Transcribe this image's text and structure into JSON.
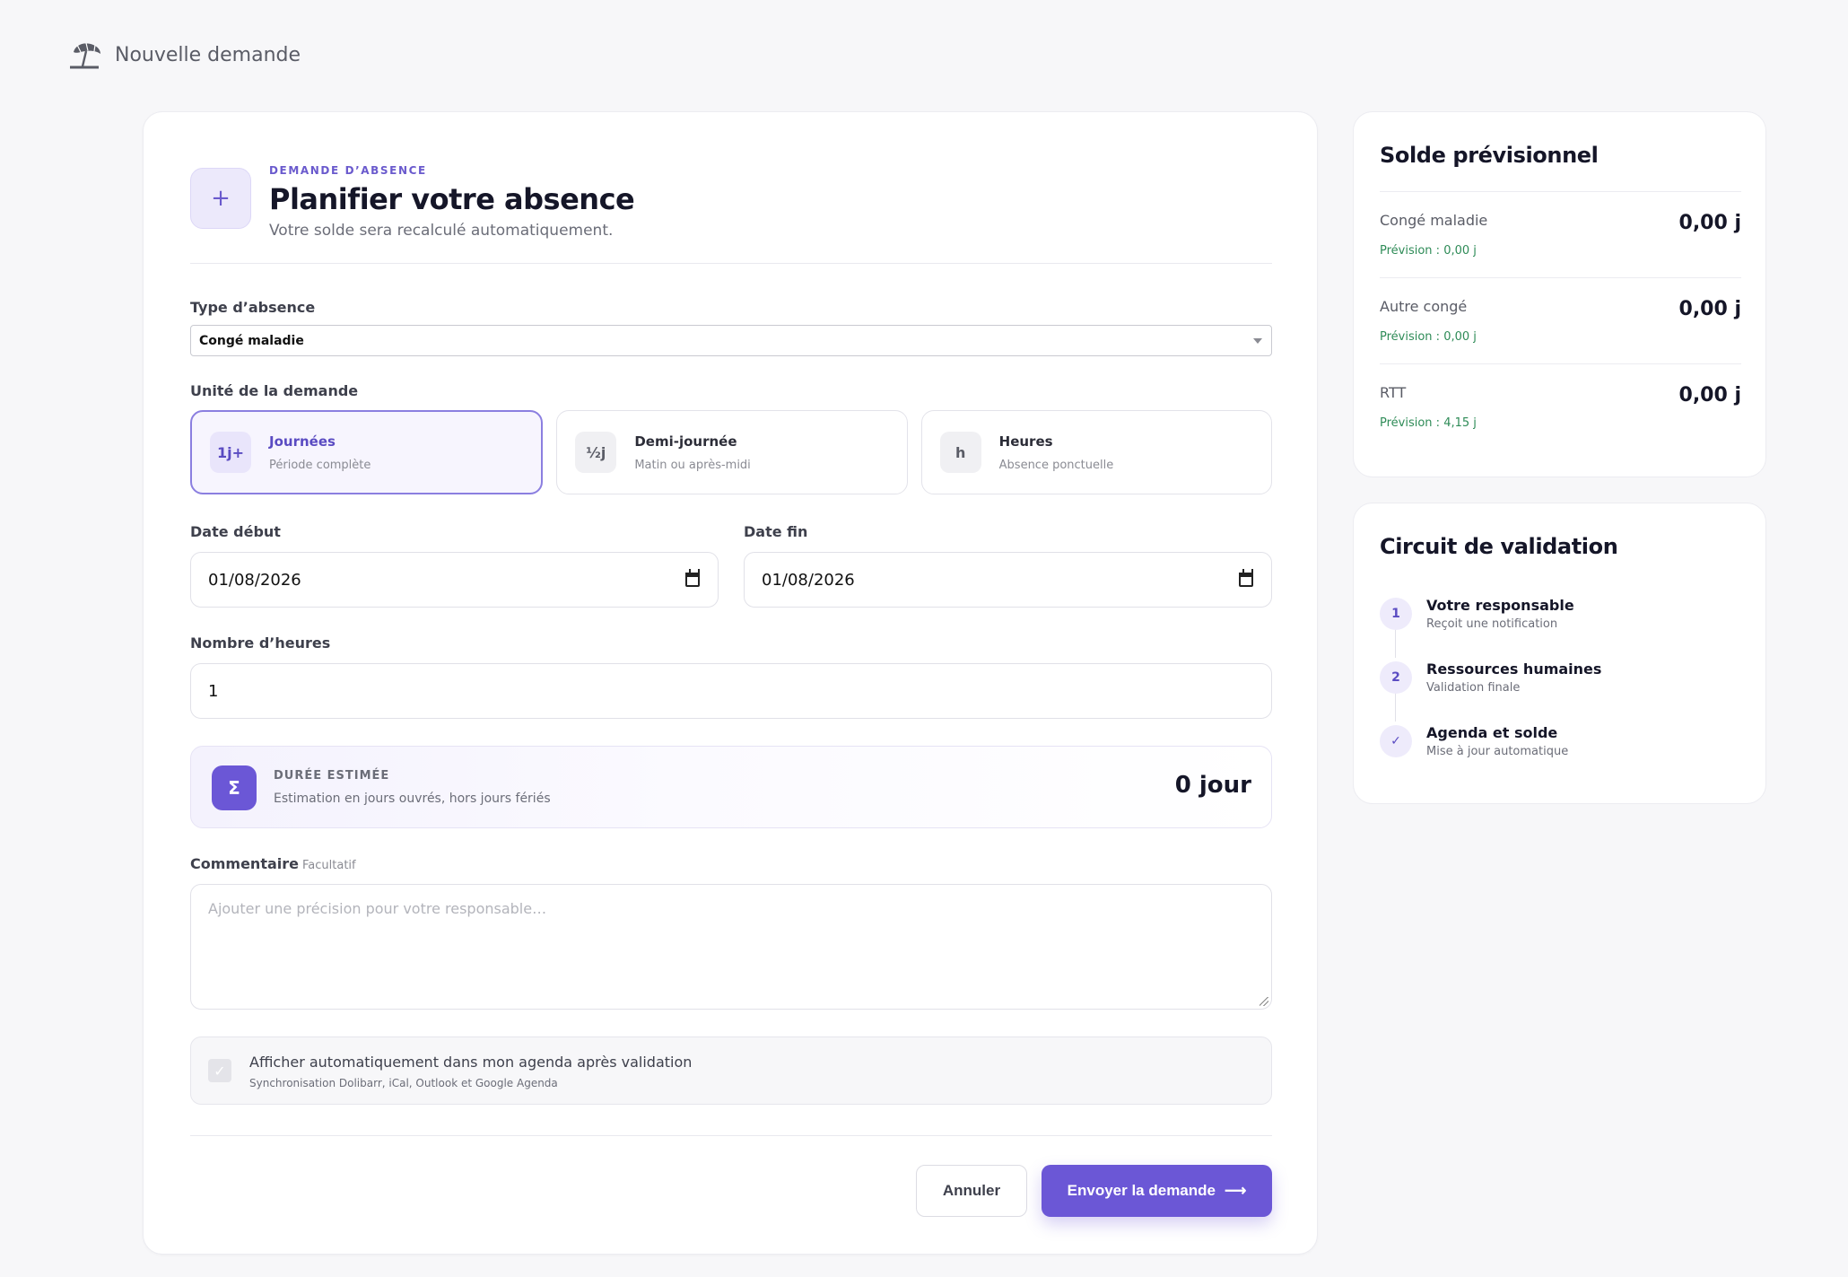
{
  "header": {
    "title": "Nouvelle demande"
  },
  "form": {
    "eyebrow": "DEMANDE D’ABSENCE",
    "title": "Planifier votre absence",
    "subtitle": "Votre solde sera recalculé automatiquement.",
    "type_label": "Type d’absence",
    "type_value": "Congé maladie",
    "unit_label": "Unité de la demande",
    "units": [
      {
        "badge": "1j+",
        "title": "Journées",
        "sub": "Période complète",
        "selected": true
      },
      {
        "badge": "½j",
        "title": "Demi-journée",
        "sub": "Matin ou après-midi",
        "selected": false
      },
      {
        "badge": "h",
        "title": "Heures",
        "sub": "Absence ponctuelle",
        "selected": false
      }
    ],
    "start_label": "Date début",
    "start_value": "01/08/2026",
    "end_label": "Date fin",
    "end_value": "01/08/2026",
    "hours_label": "Nombre d’heures",
    "hours_value": "1",
    "estimate": {
      "icon": "Σ",
      "title": "DURÉE ESTIMÉE",
      "sub": "Estimation en jours ouvrés, hors jours fériés",
      "value": "0 jour"
    },
    "comment_label": "Commentaire",
    "comment_optional": "Facultatif",
    "comment_placeholder": "Ajouter une précision pour votre responsable…",
    "sync": {
      "checked": true,
      "title": "Afficher automatiquement dans mon agenda après validation",
      "sub": "Synchronisation Dolibarr, iCal, Outlook et Google Agenda"
    },
    "cancel_label": "Annuler",
    "submit_label": "Envoyer la demande",
    "submit_arrow": "⟶"
  },
  "balance": {
    "title": "Solde prévisionnel",
    "rows": [
      {
        "name": "Congé maladie",
        "value": "0,00 j",
        "forecast": "Prévision : 0,00 j"
      },
      {
        "name": "Autre congé",
        "value": "0,00 j",
        "forecast": "Prévision : 0,00 j"
      },
      {
        "name": "RTT",
        "value": "0,00 j",
        "forecast": "Prévision : 4,15 j"
      }
    ]
  },
  "validation": {
    "title": "Circuit de validation",
    "steps": [
      {
        "marker": "1",
        "title": "Votre responsable",
        "sub": "Reçoit une notification"
      },
      {
        "marker": "2",
        "title": "Ressources humaines",
        "sub": "Validation finale"
      },
      {
        "marker": "✓",
        "title": "Agenda et solde",
        "sub": "Mise à jour automatique"
      }
    ]
  },
  "colors": {
    "accent": "#6b57d6",
    "forecast": "#2e8b57",
    "background": "#f7f7f9"
  }
}
